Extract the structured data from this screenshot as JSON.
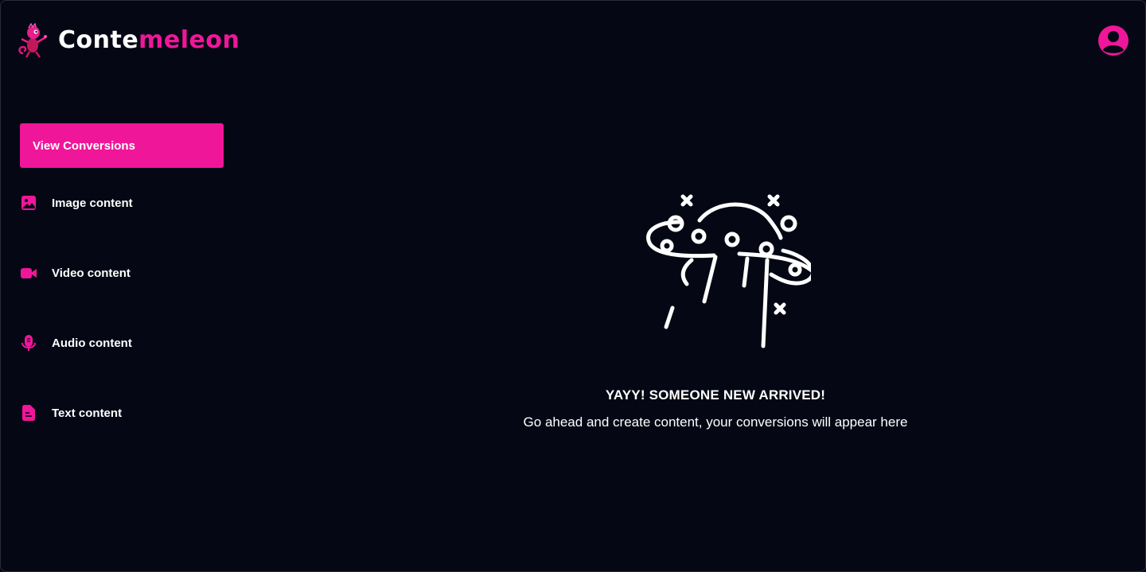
{
  "brand": {
    "name_part_1": "Conte",
    "name_part_2": "meleon",
    "accent_color": "#f0169a",
    "background_color": "#050814"
  },
  "header": {
    "avatar_icon": "user-circle-icon"
  },
  "sidebar": {
    "primary_button": "View Conversions",
    "items": [
      {
        "label": "Image content",
        "icon": "image-icon"
      },
      {
        "label": "Video content",
        "icon": "video-camera-icon"
      },
      {
        "label": "Audio content",
        "icon": "microphone-icon"
      },
      {
        "label": "Text content",
        "icon": "document-text-icon"
      }
    ]
  },
  "main": {
    "empty_state": {
      "illustration_icon": "ufo-illustration",
      "title": "YAYY! SOMEONE NEW ARRIVED!",
      "subtitle": "Go ahead and create content, your conversions will appear here"
    }
  }
}
